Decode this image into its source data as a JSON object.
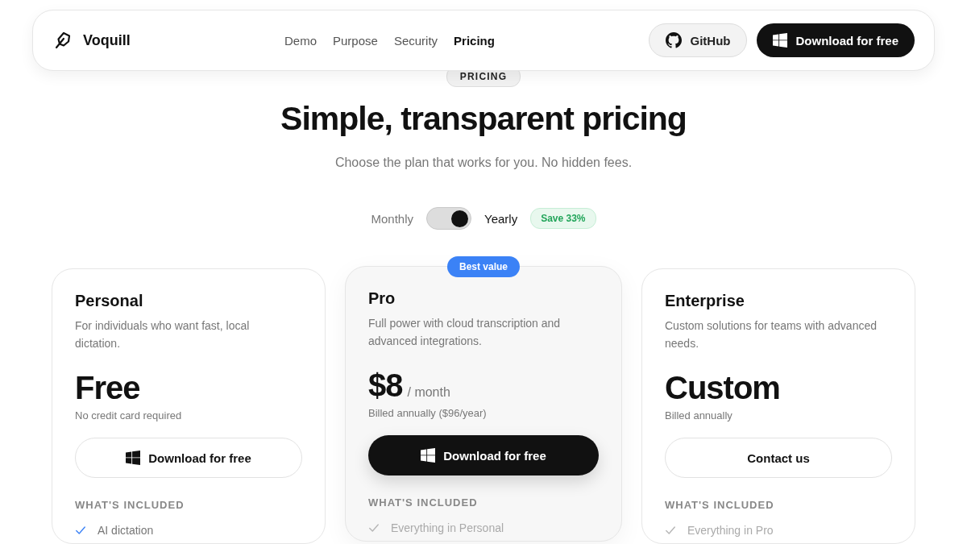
{
  "navbar": {
    "brand": "Voquill",
    "links": [
      {
        "label": "Demo",
        "selected": false
      },
      {
        "label": "Purpose",
        "selected": false
      },
      {
        "label": "Security",
        "selected": false
      },
      {
        "label": "Pricing",
        "selected": true
      }
    ],
    "github": "GitHub",
    "download": "Download for free"
  },
  "header": {
    "eyebrow": "PRICING",
    "title": "Simple, transparent pricing",
    "subtitle": "Choose the plan that works for you. No hidden fees."
  },
  "billing": {
    "options": [
      {
        "label": "Monthly",
        "selected": false
      },
      {
        "label": "Yearly",
        "selected": true
      }
    ],
    "badge": "Save 33%"
  },
  "plans": [
    {
      "name": "Personal",
      "featured": false,
      "description": "For individuals who want fast, local dictation.",
      "price": "Free",
      "note": "No credit card required",
      "button": {
        "label": "Download for free",
        "kind": "outline",
        "windows_icon": true
      },
      "included_label": "WHAT'S INCLUDED",
      "features": [
        {
          "label": "AI dictation",
          "color": "#3b82f6"
        }
      ]
    },
    {
      "name": "Pro",
      "featured": true,
      "badge": "Best value",
      "description": "Full power with cloud transcription and advanced integrations.",
      "price": "$8",
      "period": "/ month",
      "note": "Billed annually ($96/year)",
      "button": {
        "label": "Download for free",
        "kind": "solid",
        "windows_icon": true
      },
      "included_label": "WHAT'S INCLUDED",
      "features": [
        {
          "label": "Everything in Personal",
          "color": "#b5b5b5"
        }
      ]
    },
    {
      "name": "Enterprise",
      "featured": false,
      "description": "Custom solutions for teams with advanced needs.",
      "price": "Custom",
      "note": "Billed annually",
      "button": {
        "label": "Contact us",
        "kind": "outline",
        "windows_icon": false
      },
      "included_label": "WHAT'S INCLUDED",
      "features": [
        {
          "label": "Everything in Pro",
          "color": "#b5b5b5"
        }
      ]
    }
  ]
}
